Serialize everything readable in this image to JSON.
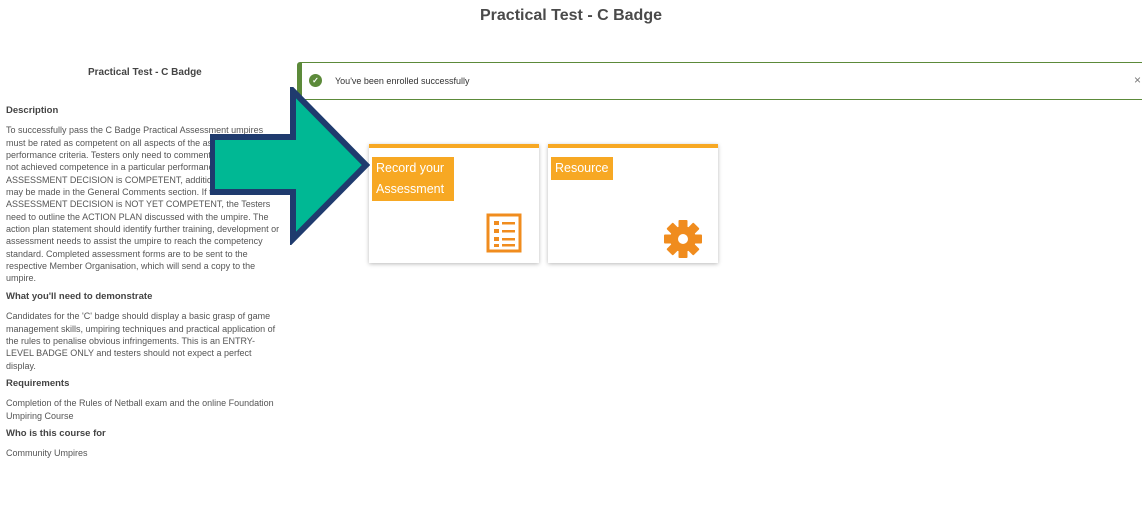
{
  "header": {
    "title": "Practical Test - C Badge"
  },
  "sidebar": {
    "title": "Practical Test - C Badge",
    "sections": [
      {
        "heading": "Description",
        "body": "To successfully pass the C Badge Practical Assessment umpires must be rated as competent on all aspects of the assessable performance criteria. Testers only need to comment if the umpire has not achieved competence in a particular performance criteria. If the ASSESSMENT DECISION is COMPETENT, additional comments may be made in the General Comments section. If the ASSESSMENT DECISION is NOT YET COMPETENT, the Testers need to outline the ACTION PLAN discussed with the umpire. The action plan statement should identify further training, development or assessment needs to assist the umpire to reach the competency standard. Completed assessment forms are to be sent to the respective Member Organisation, which will send a copy to the umpire."
      },
      {
        "heading": "What you'll need to demonstrate",
        "body": "Candidates for the 'C' badge should display a basic grasp of game management skills, umpiring techniques and practical application of the rules to penalise obvious infringements. This is an ENTRY-LEVEL BADGE ONLY and testers should not expect a perfect display."
      },
      {
        "heading": "Requirements",
        "body": "Completion of the Rules of Netball exam and the online Foundation Umpiring Course"
      },
      {
        "heading": "Who is this course for",
        "body": "Community Umpires"
      }
    ]
  },
  "alert": {
    "message": "You've been enrolled successfully",
    "close": "×",
    "check": "✓",
    "color": "#5c8a3a"
  },
  "tiles": [
    {
      "label": "Record your Assessment",
      "icon": "checklist-icon"
    },
    {
      "label": "Resource",
      "icon": "gear-icon"
    }
  ],
  "colors": {
    "accent": "#f7a823",
    "icon": "#f08c1e",
    "arrow_fill": "#00b894",
    "arrow_stroke": "#1f3b6e"
  }
}
